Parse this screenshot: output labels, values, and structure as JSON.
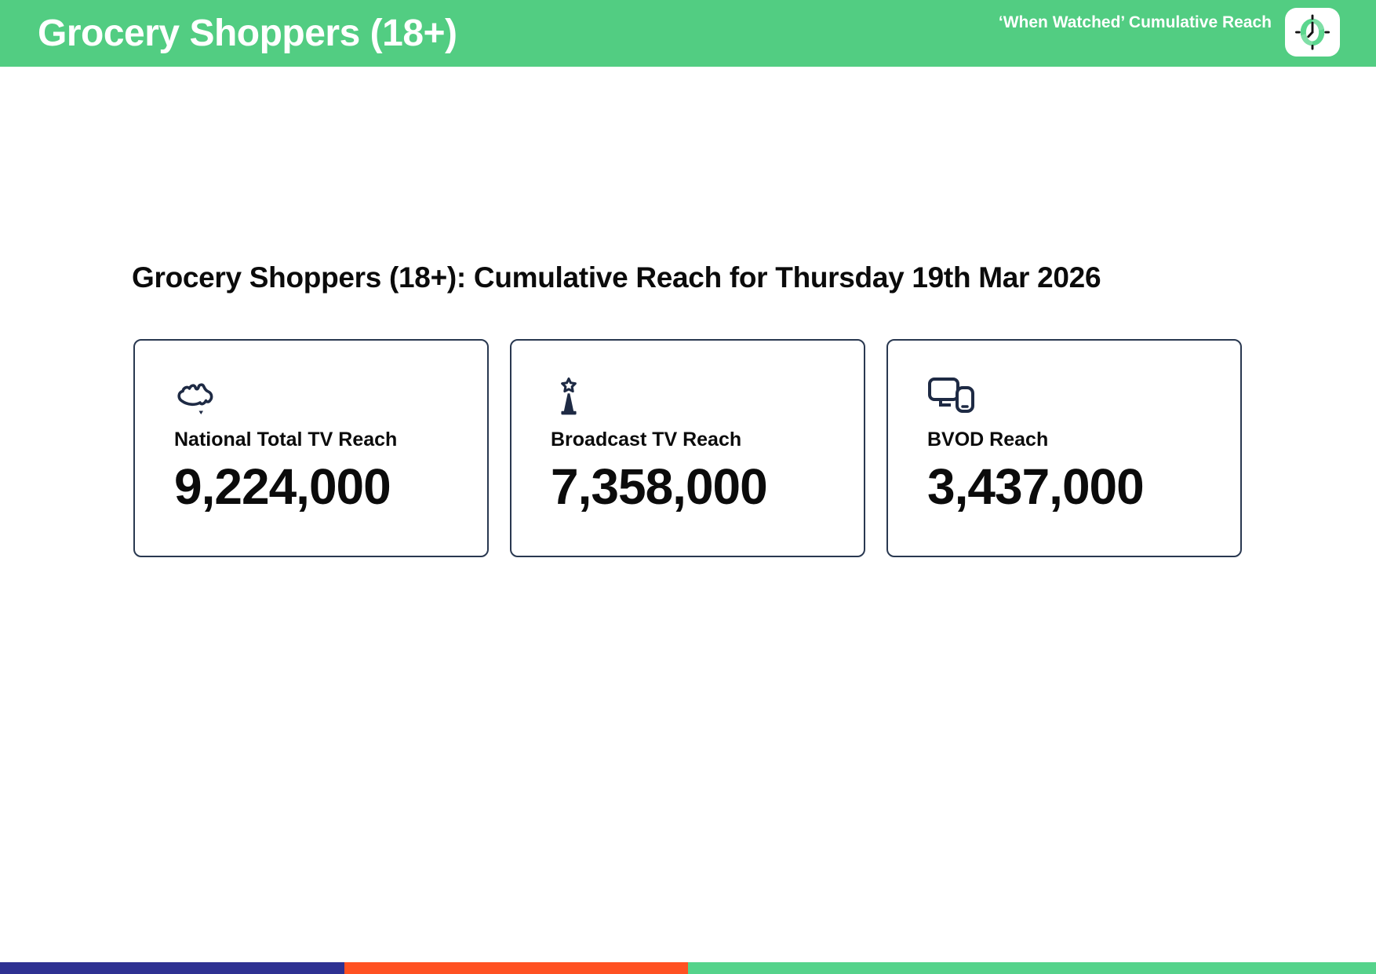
{
  "header": {
    "title": "Grocery Shoppers (18+)",
    "subtitle": "‘When Watched’ Cumulative Reach",
    "logo_icon": "clock-logo-icon"
  },
  "main": {
    "heading": "Grocery Shoppers (18+): Cumulative Reach for Thursday 19th Mar 2026",
    "cards": [
      {
        "icon": "australia-map-icon",
        "label": "National Total TV Reach",
        "value": "9,224,000"
      },
      {
        "icon": "broadcast-tower-star-icon",
        "label": "Broadcast TV Reach",
        "value": "7,358,000"
      },
      {
        "icon": "tv-and-phone-devices-icon",
        "label": "BVOD Reach",
        "value": "3,437,000"
      }
    ]
  },
  "colors": {
    "header_bg": "#52CD82",
    "icon_navy": "#1E2A44",
    "card_border": "#293850",
    "logo_ring_green": "#5BD68E",
    "logo_highlight_green": "#7FDFA6",
    "footer_blue": "#2E3192",
    "footer_orange": "#FF5122",
    "footer_green": "#55D38B"
  },
  "footer": {
    "segments": [
      {
        "name": "blue",
        "color": "#2E3192",
        "width_pct": 25
      },
      {
        "name": "orange",
        "color": "#FF5122",
        "width_pct": 25
      },
      {
        "name": "green",
        "color": "#55D38B",
        "width_pct": 50
      }
    ]
  }
}
